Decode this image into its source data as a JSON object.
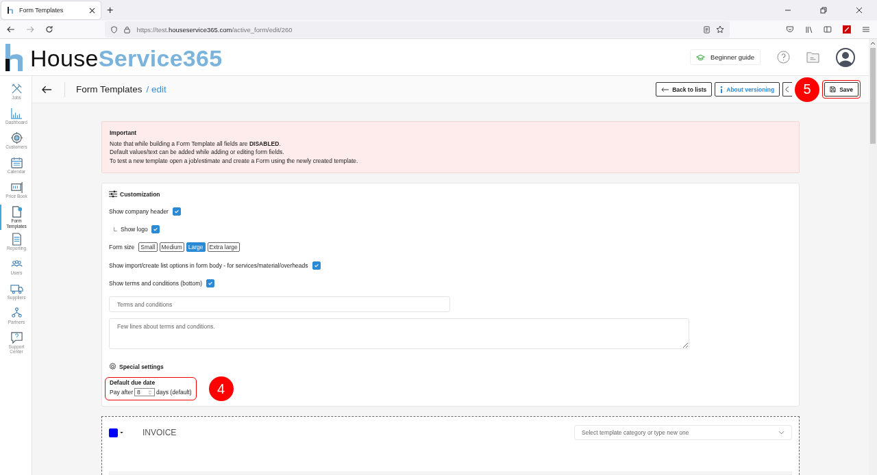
{
  "browser": {
    "tab_title": "Form Templates",
    "new_tab": "+",
    "url_prefix": "https://test.",
    "url_domain": "houseservice365.com",
    "url_path": "/active_form/edit/260"
  },
  "app": {
    "logo_dark": "House",
    "logo_light": "Service365",
    "guide_button": "Beginner guide"
  },
  "sidebar": [
    {
      "label": "Jobs",
      "kind": "tools",
      "selected": false
    },
    {
      "label": "Dashboard",
      "kind": "chart",
      "selected": false
    },
    {
      "label": "Customers",
      "kind": "target",
      "selected": false
    },
    {
      "label": "Calendar",
      "kind": "calendar",
      "selected": false
    },
    {
      "label": "Price Book",
      "kind": "price",
      "selected": false
    },
    {
      "label": "Form Templates",
      "kind": "form",
      "selected": true
    },
    {
      "label": "Reporting",
      "kind": "report",
      "selected": false
    },
    {
      "label": "Users",
      "kind": "users",
      "selected": false
    },
    {
      "label": "Suppliers",
      "kind": "truck",
      "selected": false
    },
    {
      "label": "Partners",
      "kind": "partners",
      "selected": false
    },
    {
      "label": "Support Center",
      "kind": "support",
      "selected": false
    }
  ],
  "page": {
    "title": "Form Templates",
    "subtitle": "/ edit",
    "save_callout": "5",
    "buttons": [
      {
        "kind": "back",
        "label": "Back to lists",
        "highlighted": false
      },
      {
        "kind": "info",
        "label": "About versioning",
        "highlighted": false
      },
      {
        "kind": "preview",
        "highlighted": false
      },
      {
        "kind": "save",
        "label": "Save",
        "highlighted": true
      }
    ]
  },
  "notice": {
    "title": "Important",
    "lines": [
      "Note that while building a Form Template all fields are **DISABLED**.",
      "Default values/text can be added while adding or editing form fields.",
      "To test a new template open a job/estimate and create a Form using the newly created template."
    ]
  },
  "customization": {
    "title": "Customization",
    "rows": [
      {
        "kind": "checkbox",
        "label": "Show company header",
        "checked": true,
        "children": [
          {
            "label": "Show logo",
            "checked": true
          }
        ]
      },
      {
        "kind": "sizes",
        "label": "Form size",
        "choices": [
          {
            "label": "Small",
            "selected": false
          },
          {
            "label": "Medium",
            "selected": false
          },
          {
            "label": "Large",
            "selected": true
          },
          {
            "label": "Extra large",
            "selected": false
          }
        ]
      },
      {
        "kind": "checkbox",
        "label": "Show import/create list options in form body - for services/material/overheads",
        "checked": true
      },
      {
        "kind": "checkbox",
        "label": "Show terms and conditions (bottom)",
        "checked": true
      }
    ],
    "terms_title_placeholder": "Terms and conditions",
    "terms_text_placeholder": "Few lines about terms and conditions."
  },
  "special": {
    "title": "Special settings",
    "due_label": "Default due date",
    "pay_before": "Pay after",
    "days": "8",
    "pay_after": "days (default)",
    "callout": "4"
  },
  "invoice": {
    "color": "#0000ff",
    "title": "INVOICE",
    "category_placeholder": "Select template category or type new one"
  }
}
